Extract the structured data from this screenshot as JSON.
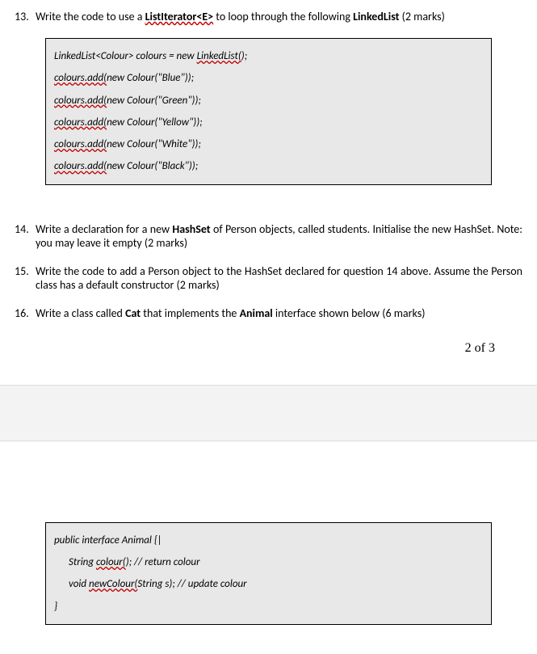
{
  "q13": {
    "num": "13.",
    "text_pre": "Write the code to use a ",
    "bold1": "ListIterator<E>",
    "text_mid": " to loop through the following ",
    "bold2": "LinkedList",
    "text_post": " (2 marks)"
  },
  "code1": {
    "line1_a": "LinkedList<Colour> colours = new ",
    "line1_b": "LinkedList(",
    "line1_c": ");",
    "line2_a": "colours.add(",
    "line2_b": "new Colour(\"Blue\"));",
    "line3_a": "colours.add(",
    "line3_b": "new Colour(\"Green\"));",
    "line4_a": "colours.add(",
    "line4_b": "new Colour(\"Yellow\"));",
    "line5_a": "colours.add(",
    "line5_b": "new Colour(\"White\"));",
    "line6_a": "colours.add(",
    "line6_b": "new Colour(\"Black\"));"
  },
  "q14": {
    "num": "14.",
    "text_a": "Write a declaration for a new ",
    "bold": "HashSet",
    "text_b": " of Person objects, called students. Initialise the new HashSet. Note: you may leave it empty (2 marks)"
  },
  "q15": {
    "num": "15.",
    "text": "Write the code to add a Person object to the HashSet declared for question 14 above. Assume the Person class has a default constructor (2 marks)"
  },
  "q16": {
    "num": "16.",
    "text_a": "Write a class called ",
    "bold1": "Cat",
    "text_b": " that implements the ",
    "bold2": "Animal",
    "text_c": " interface shown below (6 marks)"
  },
  "page_num": "2 of 3",
  "code2": {
    "line1": "public interface Animal {|",
    "line2_a": "String ",
    "line2_b": "colour(",
    "line2_c": "); // return colour",
    "line3_a": "void ",
    "line3_b": "newColour(",
    "line3_c": "String s); // update colour",
    "line4": "}"
  }
}
